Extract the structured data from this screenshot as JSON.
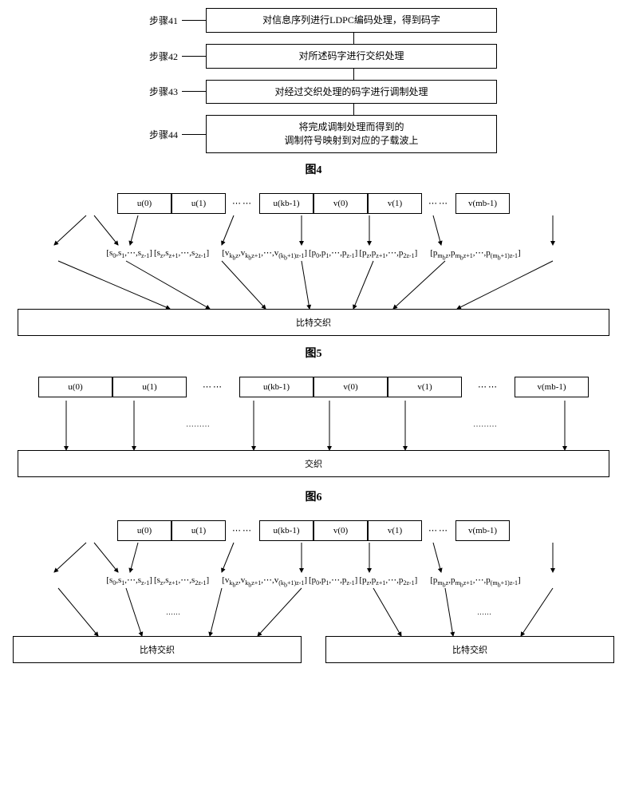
{
  "fig4": {
    "steps": [
      {
        "label": "步骤41",
        "text": "对信息序列进行LDPC编码处理，得到码字"
      },
      {
        "label": "步骤42",
        "text": "对所述码字进行交织处理"
      },
      {
        "label": "步骤43",
        "text": "对经过交织处理的码字进行调制处理"
      },
      {
        "label": "步骤44",
        "text": "将完成调制处理而得到的\n调制符号映射到对应的子载波上"
      }
    ],
    "caption": "图4"
  },
  "fig5": {
    "blocks": [
      "u(0)",
      "u(1)",
      "u(kb-1)",
      "v(0)",
      "v(1)",
      "v(mb-1)"
    ],
    "formulas": [
      "[s₀, s₁, ⋯, s_{z-1}]",
      "[s_z, s_{z+1}, ⋯, s_{2z-1}]",
      "[v_{k_b z}, v_{k_b z+1}, ⋯, v_{(k_b+1)z-1}]",
      "[p₀, p₁, ⋯, p_{z-1}]",
      "[p_z, p_{z+1}, ⋯, p_{2z-1}]",
      "[p_{m_b z}, p_{m_b z+1}, ⋯, p_{(m_b+1)z-1}]"
    ],
    "bottom": "比特交织",
    "caption": "图5"
  },
  "fig6": {
    "blocks": [
      "u(0)",
      "u(1)",
      "u(kb-1)",
      "v(0)",
      "v(1)",
      "v(mb-1)"
    ],
    "bottom": "交织",
    "caption": "图6"
  },
  "fig7": {
    "blocks": [
      "u(0)",
      "u(1)",
      "u(kb-1)",
      "v(0)",
      "v(1)",
      "v(mb-1)"
    ],
    "formulas": [
      "[s₀, s₁, ⋯, s_{z-1}]",
      "[s_z, s_{z+1}, ⋯, s_{2z-1}]",
      "[v_{k_b z}, v_{k_b z+1}, ⋯, v_{(k_b+1)z-1}]",
      "[p₀, p₁, ⋯, p_{z-1}]",
      "[p_z, p_{z+1}, ⋯, p_{2z-1}]",
      "[p_{m_b z}, p_{m_b z+1}, ⋯, p_{(m_b+1)z-1}]"
    ],
    "bottom_left": "比特交织",
    "bottom_right": "比特交织"
  },
  "chart_data": {
    "type": "diagram",
    "note": "Process flowchart (图4) and three block-interleaving diagrams (图5/图6/图7) illustrating LDPC codeword bit-interleaving structures."
  }
}
